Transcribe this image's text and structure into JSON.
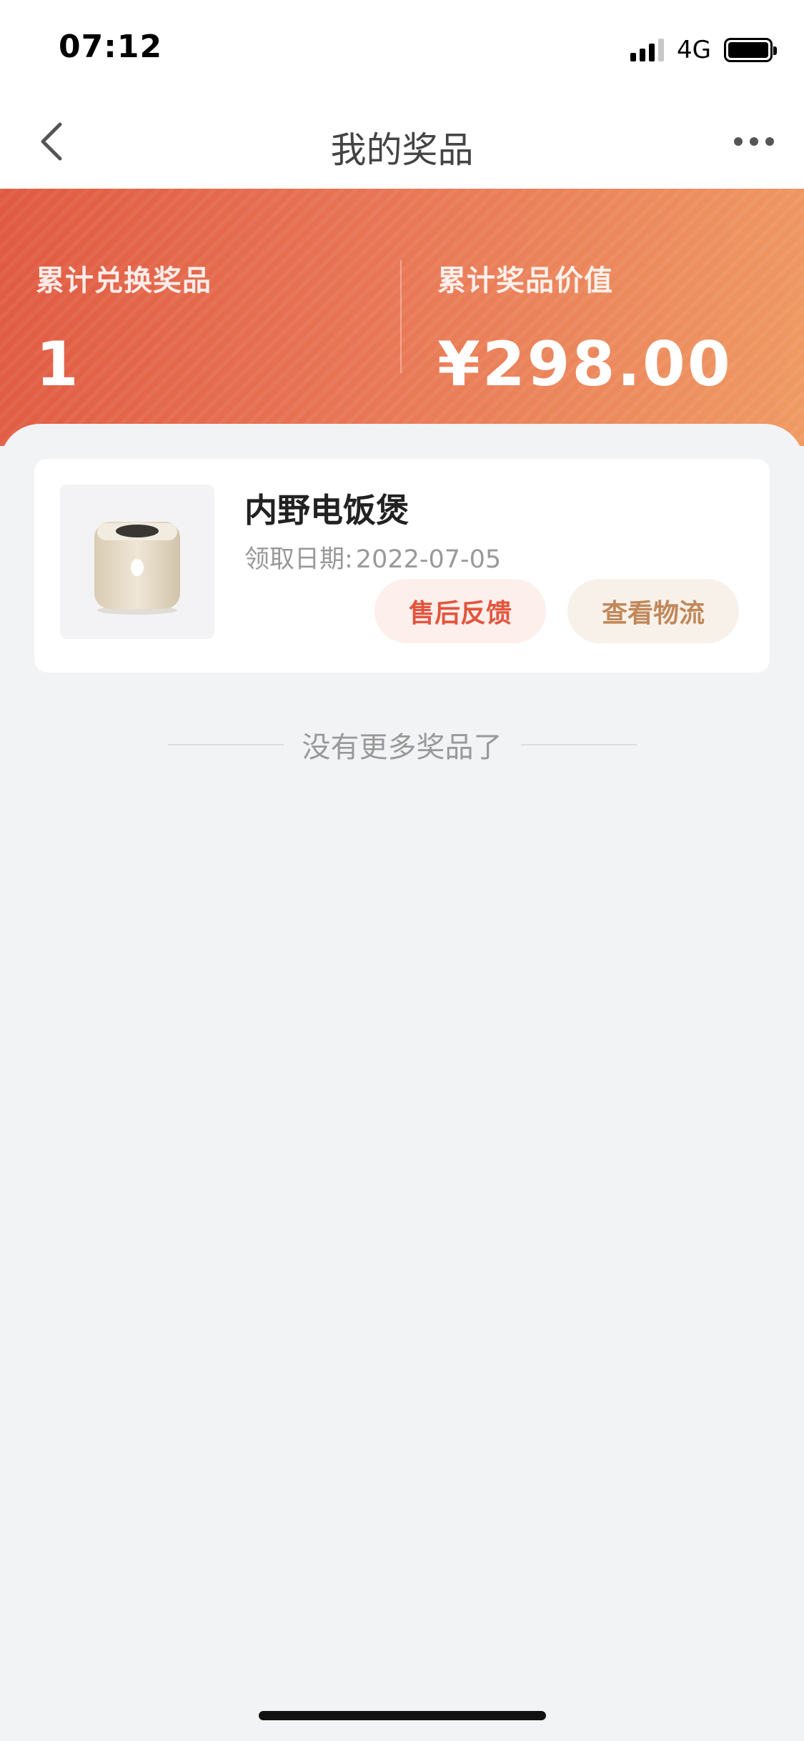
{
  "status_bar": {
    "time": "07:12",
    "network": "4G",
    "icons": [
      "signal-icon",
      "battery-icon"
    ]
  },
  "nav": {
    "title": "我的奖品",
    "back_icon": "chevron-left-icon",
    "more_icon": "more-horizontal-icon"
  },
  "summary": {
    "count_label": "累计兑换奖品",
    "count_value": "1",
    "value_label": "累计奖品价值",
    "value_value": "¥298.00"
  },
  "prizes": [
    {
      "name": "内野电饭煲",
      "date_label": "领取日期:",
      "date": "2022-07-05",
      "feedback_label": "售后反馈",
      "logistics_label": "查看物流",
      "thumb_icon": "rice-cooker-image"
    }
  ],
  "footer": {
    "end_text": "没有更多奖品了"
  },
  "colors": {
    "banner_start": "#e05a41",
    "banner_end": "#ef9a63",
    "feedback_text": "#e2553d",
    "logistics_text": "#c0885a",
    "page_bg": "#f2f3f5"
  }
}
